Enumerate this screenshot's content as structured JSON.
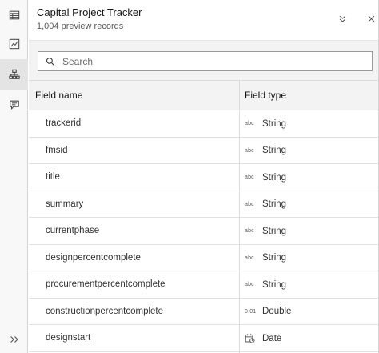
{
  "header": {
    "title": "Capital Project Tracker",
    "subtitle": "1,004 preview records"
  },
  "rail": {
    "items": [
      {
        "icon": "table-icon",
        "active": false
      },
      {
        "icon": "chart-icon",
        "active": false
      },
      {
        "icon": "hierarchy-icon",
        "active": true
      },
      {
        "icon": "comment-icon",
        "active": false
      }
    ],
    "expand_icon": "double-chevron-right-icon"
  },
  "search": {
    "placeholder": "Search",
    "value": ""
  },
  "table": {
    "columns": [
      "Field name",
      "Field type"
    ],
    "rows": [
      {
        "name": "trackerid",
        "type": "String",
        "type_icon": "abc"
      },
      {
        "name": "fmsid",
        "type": "String",
        "type_icon": "abc"
      },
      {
        "name": "title",
        "type": "String",
        "type_icon": "abc"
      },
      {
        "name": "summary",
        "type": "String",
        "type_icon": "abc"
      },
      {
        "name": "currentphase",
        "type": "String",
        "type_icon": "abc"
      },
      {
        "name": "designpercentcomplete",
        "type": "String",
        "type_icon": "abc"
      },
      {
        "name": "procurementpercentcomplete",
        "type": "String",
        "type_icon": "abc"
      },
      {
        "name": "constructionpercentcomplete",
        "type": "Double",
        "type_icon": "0.01"
      },
      {
        "name": "designstart",
        "type": "Date",
        "type_icon": "calendar-icon"
      }
    ]
  },
  "colors": {
    "rail_bg": "#f8f8f8",
    "rail_active": "#e4e4e4",
    "header_row_bg": "#f3f3f3",
    "text": "#323232"
  }
}
